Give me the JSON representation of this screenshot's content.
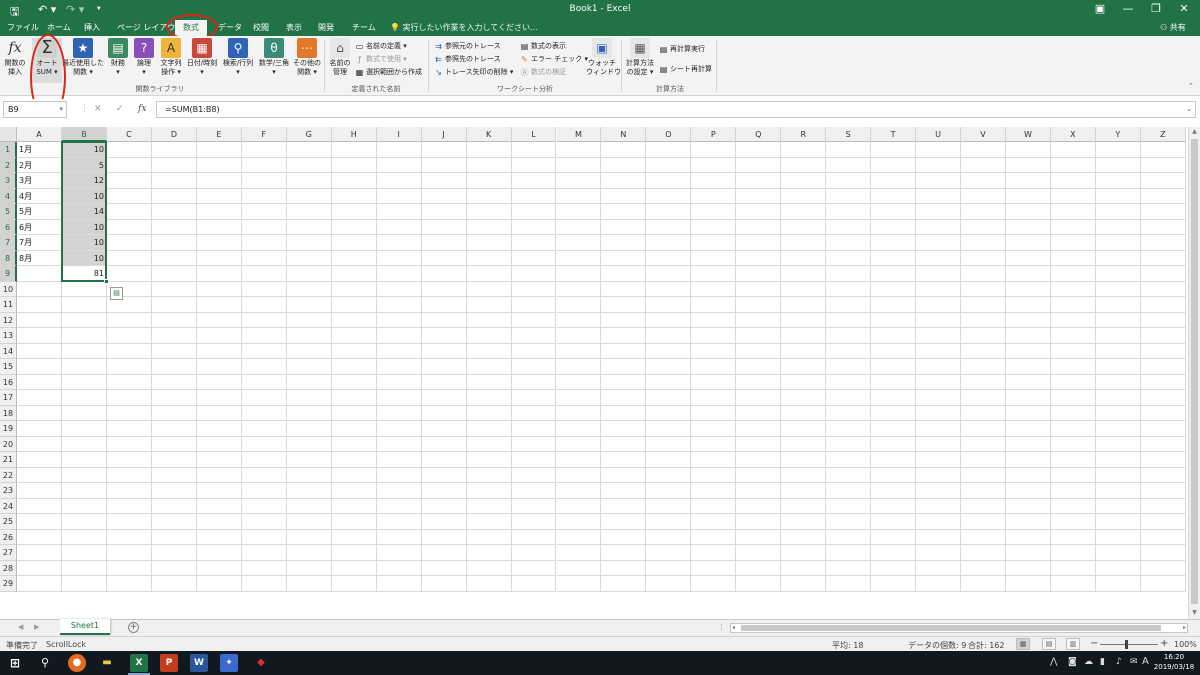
{
  "window": {
    "title": "Book1 - Excel",
    "qa_save": "🖫",
    "qa_undo": "↶ ▾",
    "qa_redo": "↷ ▾",
    "qa_custom": "⯆"
  },
  "tabs": [
    "ファイル",
    "ホーム",
    "挿入",
    "ページ レイアウト",
    "数式",
    "データ",
    "校閲",
    "表示",
    "開発",
    "チーム"
  ],
  "active_tab": "数式",
  "tell_me": "実行したい作業を入力してください...",
  "share": "共有",
  "ribbon": {
    "insert_function": "関数の\n挿入",
    "autosum": "オート\nSUM ▾",
    "recent": "最近使用した\n関数 ▾",
    "financial": "財務\n▾",
    "logical": "論理\n▾",
    "text": "文字列\n操作 ▾",
    "datetime": "日付/時刻\n▾",
    "lookup": "検索/行列\n▾",
    "math": "数学/三角\n▾",
    "more": "その他の\n関数 ▾",
    "group_library": "関数ライブラリ",
    "name_manager": "名前の\n管理",
    "define_name": "名前の定義 ▾",
    "use_in_formula": "数式で使用 ▾",
    "create_from_selection": "選択範囲から作成",
    "group_names": "定義された名前",
    "trace_precedents": "参照元のトレース",
    "trace_dependents": "参照先のトレース",
    "remove_arrows": "トレース矢印の削除 ▾",
    "show_formulas": "数式の表示",
    "error_checking": "エラー チェック ▾",
    "evaluate_formula": "数式の検証",
    "watch_window": "ウォッチ\nウィンドウ",
    "group_audit": "ワークシート分析",
    "calc_options": "計算方法\nの設定 ▾",
    "calc_now": "再計算実行",
    "calc_sheet": "シート再計算",
    "group_calc": "計算方法"
  },
  "formula_bar": {
    "name_box": "B9",
    "cancel": "✕",
    "enter": "✓",
    "fx": "fx",
    "formula": "=SUM(B1:B8)"
  },
  "columns": [
    "A",
    "B",
    "C",
    "D",
    "E",
    "F",
    "G",
    "H",
    "I",
    "J",
    "K",
    "L",
    "M",
    "N",
    "O",
    "P",
    "Q",
    "R",
    "S",
    "T",
    "U",
    "V",
    "W",
    "X",
    "Y",
    "Z"
  ],
  "rows": [
    "1",
    "2",
    "3",
    "4",
    "5",
    "6",
    "7",
    "8",
    "9",
    "10",
    "11",
    "12",
    "13",
    "14",
    "15",
    "16",
    "17",
    "18",
    "19",
    "20",
    "21",
    "22",
    "23",
    "24",
    "25",
    "26",
    "27",
    "28",
    "29"
  ],
  "cells_a": [
    "1月",
    "2月",
    "3月",
    "4月",
    "5月",
    "6月",
    "7月",
    "8月"
  ],
  "cells_b": [
    "10",
    "5",
    "12",
    "10",
    "14",
    "10",
    "10",
    "10",
    "81"
  ],
  "sheet_tab": "Sheet1",
  "status": {
    "ready": "準備完了",
    "scroll_lock": "ScrollLock",
    "average": "平均: 18",
    "count": "データの個数: 9",
    "sum": "合計: 162",
    "zoom": "100%"
  },
  "taskbar": {
    "time": "16:20",
    "date": "2019/03/18",
    "ime": "A"
  }
}
